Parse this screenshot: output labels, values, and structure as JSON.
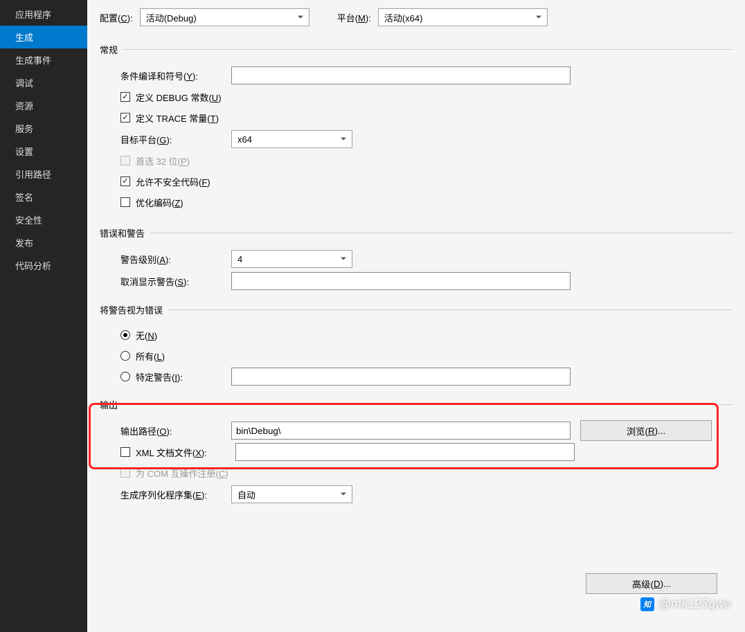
{
  "sidebar": {
    "items": [
      {
        "label": "应用程序"
      },
      {
        "label": "生成"
      },
      {
        "label": "生成事件"
      },
      {
        "label": "调试"
      },
      {
        "label": "资源"
      },
      {
        "label": "服务"
      },
      {
        "label": "设置"
      },
      {
        "label": "引用路径"
      },
      {
        "label": "签名"
      },
      {
        "label": "安全性"
      },
      {
        "label": "发布"
      },
      {
        "label": "代码分析"
      }
    ],
    "active_index": 1
  },
  "top": {
    "config_label_pre": "配置(",
    "config_key": "C",
    "config_label_post": "):",
    "config_value": "活动(Debug)",
    "platform_label_pre": "平台(",
    "platform_key": "M",
    "platform_label_post": "):",
    "platform_value": "活动(x64)"
  },
  "sections": {
    "general": "常规",
    "errors": "错误和警告",
    "treat_as_error": "将警告视为错误",
    "output": "输出"
  },
  "general": {
    "symbols_label_pre": "条件编译和符号(",
    "symbols_key": "Y",
    "symbols_label_post": "):",
    "symbols_value": "",
    "debug_label_pre": "定义 DEBUG 常数(",
    "debug_key": "U",
    "debug_label_post": ")",
    "trace_label_pre": "定义 TRACE 常量(",
    "trace_key": "T",
    "trace_label_post": ")",
    "target_label_pre": "目标平台(",
    "target_key": "G",
    "target_label_post": "):",
    "target_value": "x64",
    "prefer32_label_pre": "首选 32 位(",
    "prefer32_key": "P",
    "prefer32_label_post": ")",
    "unsafe_label_pre": "允许不安全代码(",
    "unsafe_key": "F",
    "unsafe_label_post": ")",
    "optimize_label_pre": "优化编码(",
    "optimize_key": "Z",
    "optimize_label_post": ")"
  },
  "errors": {
    "level_label_pre": "警告级别(",
    "level_key": "A",
    "level_label_post": "):",
    "level_value": "4",
    "suppress_label_pre": "取消显示警告(",
    "suppress_key": "S",
    "suppress_label_post": "):",
    "suppress_value": ""
  },
  "treat": {
    "none_pre": "无(",
    "none_key": "N",
    "none_post": ")",
    "all_pre": "所有(",
    "all_key": "L",
    "all_post": ")",
    "specific_pre": "特定警告(",
    "specific_key": "I",
    "specific_post": "):",
    "specific_value": ""
  },
  "output": {
    "path_label_pre": "输出路径(",
    "path_key": "O",
    "path_label_post": "):",
    "path_value": "bin\\Debug\\",
    "browse_pre": "浏览(",
    "browse_key": "R",
    "browse_post": ")...",
    "xml_label_pre": "XML 文档文件(",
    "xml_key": "X",
    "xml_label_post": "):",
    "xml_value": "",
    "com_label_pre": "为 COM 互操作注册(",
    "com_key": "C",
    "com_label_post": ")",
    "serial_label_pre": "生成序列化程序集(",
    "serial_key": "E",
    "serial_label_post": "):",
    "serial_value": "自动",
    "advanced_pre": "高级(",
    "advanced_key": "D",
    "advanced_post": ")..."
  },
  "watermark": "@mk123qwe"
}
